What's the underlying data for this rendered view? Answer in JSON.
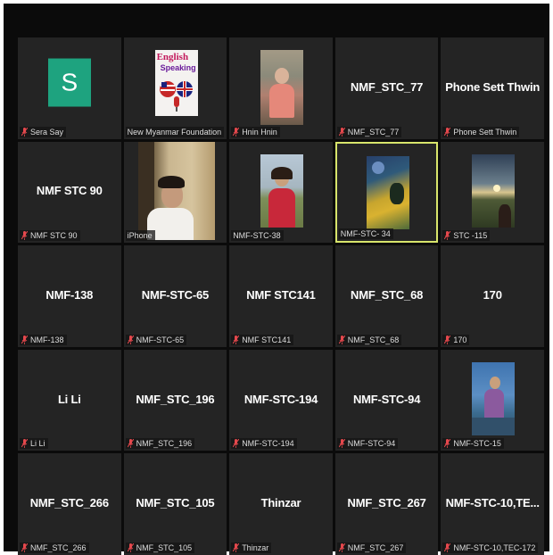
{
  "participants": [
    {
      "label": "Sera Say",
      "muted": true,
      "display": "avatar",
      "avatar_letter": "S"
    },
    {
      "label": "New Myanmar Foundation",
      "muted": false,
      "display": "logo",
      "logo_text": [
        "English",
        "Speaking"
      ]
    },
    {
      "label": "Hnin Hnin",
      "muted": true,
      "display": "photo"
    },
    {
      "label": "NMF_STC_77",
      "muted": true,
      "display": "name",
      "center_name": "NMF_STC_77"
    },
    {
      "label": "Phone Sett Thwin",
      "muted": true,
      "display": "name",
      "center_name": "Phone Sett Thwin"
    },
    {
      "label": "NMF STC 90",
      "muted": true,
      "display": "name",
      "center_name": "NMF STC 90"
    },
    {
      "label": "iPhone",
      "muted": false,
      "display": "video"
    },
    {
      "label": "NMF-STC-38",
      "muted": false,
      "display": "photo"
    },
    {
      "label": "NMF-STC- 34",
      "muted": false,
      "display": "photo",
      "active_speaker": true
    },
    {
      "label": "STC -115",
      "muted": true,
      "display": "photo"
    },
    {
      "label": "NMF-138",
      "muted": true,
      "display": "name",
      "center_name": "NMF-138"
    },
    {
      "label": "NMF-STC-65",
      "muted": true,
      "display": "name",
      "center_name": "NMF-STC-65"
    },
    {
      "label": "NMF STC141",
      "muted": true,
      "display": "name",
      "center_name": "NMF STC141"
    },
    {
      "label": "NMF_STC_68",
      "muted": true,
      "display": "name",
      "center_name": "NMF_STC_68"
    },
    {
      "label": "170",
      "muted": true,
      "display": "name",
      "center_name": "170"
    },
    {
      "label": "Li Li",
      "muted": true,
      "display": "name",
      "center_name": "Li Li"
    },
    {
      "label": "NMF_STC_196",
      "muted": true,
      "display": "name",
      "center_name": "NMF_STC_196"
    },
    {
      "label": "NMF-STC-194",
      "muted": true,
      "display": "name",
      "center_name": "NMF-STC-194"
    },
    {
      "label": "NMF-STC-94",
      "muted": true,
      "display": "name",
      "center_name": "NMF-STC-94"
    },
    {
      "label": "NMF-STC-15",
      "muted": true,
      "display": "photo"
    },
    {
      "label": "NMF_STC_266",
      "muted": true,
      "display": "name",
      "center_name": "NMF_STC_266"
    },
    {
      "label": "NMF_STC_105",
      "muted": true,
      "display": "name",
      "center_name": "NMF_STC_105"
    },
    {
      "label": "Thinzar",
      "muted": true,
      "display": "name",
      "center_name": "Thinzar"
    },
    {
      "label": "NMF_STC_267",
      "muted": true,
      "display": "name",
      "center_name": "NMF_STC_267"
    },
    {
      "label": "NMF-STC-10,TEC-172",
      "muted": true,
      "display": "name",
      "center_name": "NMF-STC-10,TE..."
    }
  ],
  "colors": {
    "tile_background": "#242424",
    "active_speaker_border": "#d8e56b",
    "muted_icon": "#e5484d",
    "avatar_background": "#1ea37f"
  }
}
